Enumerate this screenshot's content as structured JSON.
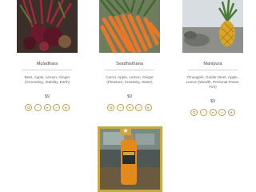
{
  "products": [
    {
      "name": "Muladhara",
      "description": "Beet, Apple, Lemon, Ginger (Grounding, Stability, Earth)",
      "price": "$9",
      "image_icon": "beet-photo",
      "icons": [
        "leaf-icon",
        "grain-icon",
        "drop-icon",
        "milk-icon",
        "nut-icon"
      ]
    },
    {
      "name": "Svadhisthana",
      "description": "Carrot, Apple, Lemon, Ginger (Pleasure, Creativity, Water)",
      "price": "$9",
      "image_icon": "carrot-photo",
      "icons": [
        "leaf-icon",
        "grain-icon",
        "drop-icon",
        "milk-icon",
        "nut-icon"
      ]
    },
    {
      "name": "Manipura",
      "description": "Pineapple, Golden Beet, Apple, Lemon (Wealth, Personal Power, Fire)",
      "price": "$9",
      "image_icon": "pineapple-photo",
      "icons": [
        "leaf-icon",
        "grain-icon",
        "drop-icon",
        "milk-icon",
        "nut-icon"
      ]
    }
  ],
  "featured": {
    "badge_icon": "star-icon",
    "image_icon": "juice-bottle-photo"
  },
  "colors": {
    "accent": "#c9a646",
    "icon_stroke": "#b8a048",
    "rule": "#cfcfcf"
  }
}
